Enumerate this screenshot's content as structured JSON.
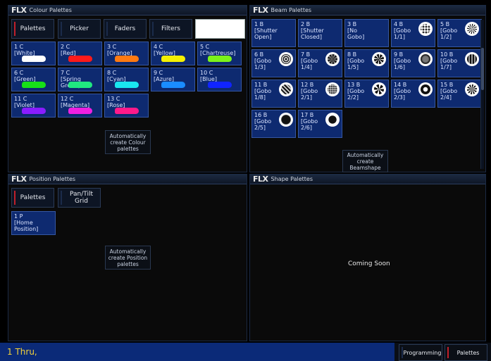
{
  "logo_text": "FLX",
  "colour_panel": {
    "title": "Colour Palettes",
    "tabs": [
      "Palettes",
      "Picker",
      "Faders",
      "Filters"
    ],
    "tiles": [
      {
        "num": "1 C",
        "name": "[White]",
        "color": "#ffffff"
      },
      {
        "num": "2 C",
        "name": "[Red]",
        "color": "#ff1a1a"
      },
      {
        "num": "3 C",
        "name": "[Orange]",
        "color": "#ff7a12"
      },
      {
        "num": "4 C",
        "name": "[Yellow]",
        "color": "#f5f000"
      },
      {
        "num": "5 C",
        "name": "[Chartreuse]",
        "color": "#7cf21a"
      },
      {
        "num": "6 C",
        "name": "[Green]",
        "color": "#17e017"
      },
      {
        "num": "7 C",
        "name": "[Spring Green]",
        "color": "#20e880"
      },
      {
        "num": "8 C",
        "name": "[Cyan]",
        "color": "#19e6f0"
      },
      {
        "num": "9 C",
        "name": "[Azure]",
        "color": "#1a8cff"
      },
      {
        "num": "10 C",
        "name": "[Blue]",
        "color": "#1024ff"
      },
      {
        "num": "11 C",
        "name": "[Violet]",
        "color": "#8a1cff"
      },
      {
        "num": "12 C",
        "name": "[Magenta]",
        "color": "#f020e0"
      },
      {
        "num": "13 C",
        "name": "[Rose]",
        "color": "#ff1a8a"
      }
    ],
    "auto_label": "Automatically create Colour palettes"
  },
  "beam_panel": {
    "title": "Beam Palettes",
    "tiles": [
      {
        "num": "1 B",
        "name": "[Shutter Open]",
        "icon": ""
      },
      {
        "num": "2 B",
        "name": "[Shutter Closed]",
        "icon": ""
      },
      {
        "num": "3 B",
        "name": "[No Gobo]",
        "icon": ""
      },
      {
        "num": "4 B",
        "name": "[Gobo 1/1]",
        "icon": "gobo-dots-icon"
      },
      {
        "num": "5 B",
        "name": "[Gobo 1/2]",
        "icon": "gobo-star-icon"
      },
      {
        "num": "6 B",
        "name": "[Gobo 1/3]",
        "icon": "gobo-rings-icon"
      },
      {
        "num": "7 B",
        "name": "[Gobo 1/4]",
        "icon": "gobo-spiral-icon"
      },
      {
        "num": "8 B",
        "name": "[Gobo 1/5]",
        "icon": "gobo-flower-icon"
      },
      {
        "num": "9 B",
        "name": "[Gobo 1/6]",
        "icon": "gobo-texture-icon"
      },
      {
        "num": "10 B",
        "name": "[Gobo 1/7]",
        "icon": "gobo-grid-icon"
      },
      {
        "num": "11 B",
        "name": "[Gobo 1/8]",
        "icon": "gobo-lines-icon"
      },
      {
        "num": "12 B",
        "name": "[Gobo 2/1]",
        "icon": "gobo-dotfield-icon"
      },
      {
        "num": "13 B",
        "name": "[Gobo 2/2]",
        "icon": "gobo-swirl-icon"
      },
      {
        "num": "14 B",
        "name": "[Gobo 2/3]",
        "icon": "gobo-ring-icon"
      },
      {
        "num": "15 B",
        "name": "[Gobo 2/4]",
        "icon": "gobo-leaf-icon"
      },
      {
        "num": "16 B",
        "name": "[Gobo 2/5]",
        "icon": "gobo-disc-icon"
      },
      {
        "num": "17 B",
        "name": "[Gobo 2/6]",
        "icon": "gobo-circle-icon"
      }
    ],
    "auto_label": "Automatically create Beamshape"
  },
  "position_panel": {
    "title": "Position Palettes",
    "tabs": [
      "Palettes",
      "Pan/Tilt Grid"
    ],
    "tiles": [
      {
        "num": "1 P",
        "name": "[Home Position]"
      }
    ],
    "auto_label": "Automatically create Position palettes"
  },
  "shape_panel": {
    "title": "Shape Palettes",
    "message": "Coming Soon"
  },
  "command_line": {
    "text": "1 Thru,"
  },
  "bottom_buttons": {
    "programming": "Programming",
    "palettes": "Palettes"
  }
}
